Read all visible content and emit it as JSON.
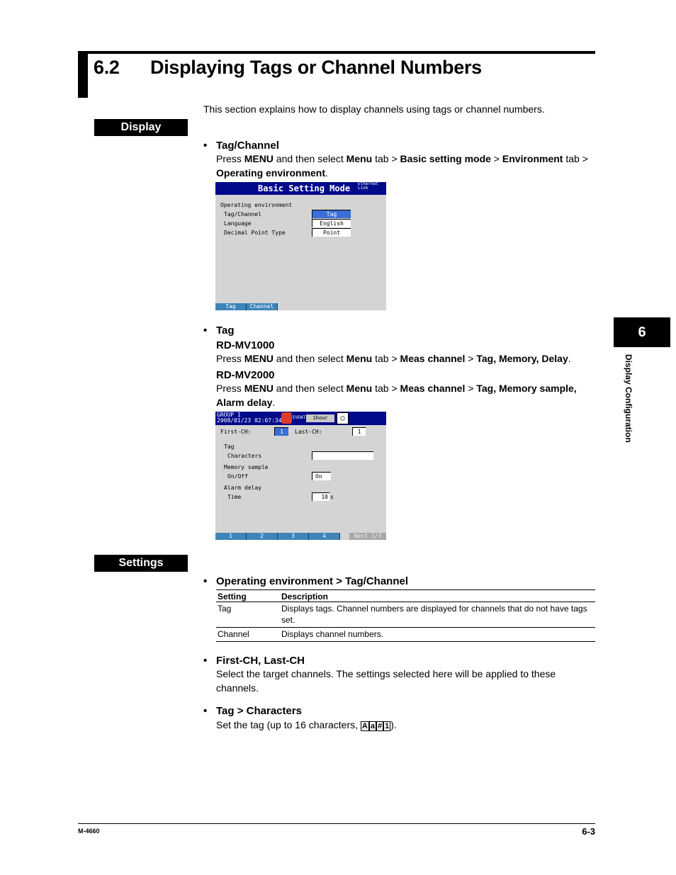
{
  "header": {
    "section_number": "6.2",
    "section_title": "Displaying Tags or Channel Numbers"
  },
  "intro": "This section explains how to display channels using tags or channel numbers.",
  "labels": {
    "display": "Display",
    "settings": "Settings"
  },
  "display": {
    "tag_channel": {
      "heading": "Tag/Channel",
      "parts": [
        "Press ",
        "MENU",
        " and then select ",
        "Menu",
        " tab > ",
        "Basic setting mode",
        " > ",
        "Environment",
        " tab >",
        "Operating environment",
        "."
      ]
    },
    "screen1": {
      "title": "Basic Setting Mode",
      "status": "Ethernet Link",
      "group": "Operating environment",
      "rows": [
        {
          "label": "Tag/Channel",
          "value": "Tag",
          "selected": true
        },
        {
          "label": "Language",
          "value": "English",
          "selected": false
        },
        {
          "label": "Decimal Point Type",
          "value": "Point",
          "selected": false
        }
      ],
      "softkeys": [
        "Tag",
        "Channel"
      ]
    },
    "tag": {
      "heading": "Tag",
      "mv1000": {
        "model": "RD-MV1000",
        "parts": [
          "Press ",
          "MENU",
          " and then select ",
          "Menu",
          " tab > ",
          "Meas channel",
          " > ",
          "Tag, Memory, Delay",
          "."
        ]
      },
      "mv2000": {
        "model": "RD-MV2000",
        "parts": [
          "Press ",
          "MENU",
          " and then select ",
          "Menu",
          " tab > ",
          "Meas channel",
          " > ",
          "Tag, Memory sample,",
          "Alarm delay",
          "."
        ]
      }
    },
    "screen2": {
      "group": "GROUP 1",
      "datetime": "2008/01/23 02:07:34",
      "event": "EVENT",
      "interval": "1hour",
      "first_ch_label": "First-CH:",
      "first_ch": "1",
      "last_ch_label": "Last-CH:",
      "last_ch": "1",
      "tag_label": "Tag",
      "characters_label": "Characters",
      "characters_value": "",
      "memory_label": "Memory sample",
      "onoff_label": "On/Off",
      "onoff_value": "On",
      "alarm_label": "Alarm delay",
      "time_label": "Time",
      "time_value": "10",
      "time_unit": "s",
      "softkeys": [
        "1",
        "2",
        "3",
        "4"
      ],
      "next": "Next 1/3"
    }
  },
  "settings": {
    "openv": {
      "heading": "Operating environment > Tag/Channel",
      "columns": [
        "Setting",
        "Description"
      ],
      "rows": [
        {
          "setting": "Tag",
          "description": "Displays tags. Channel numbers are displayed for channels that do not have tags set."
        },
        {
          "setting": "Channel",
          "description": "Displays channel numbers."
        }
      ]
    },
    "firstlast": {
      "heading": "First-CH, Last-CH",
      "text": "Select the target channels. The settings selected here will be applied to these channels."
    },
    "characters": {
      "heading": "Tag > Characters",
      "text_before": "Set the tag (up to 16 characters, ",
      "chars": [
        "A",
        "a",
        "#",
        "1"
      ],
      "text_after": ")."
    }
  },
  "side_tab": {
    "number": "6",
    "text": "Display Configuration"
  },
  "footer": {
    "doc_id": "M-4660",
    "page": "6-3"
  }
}
